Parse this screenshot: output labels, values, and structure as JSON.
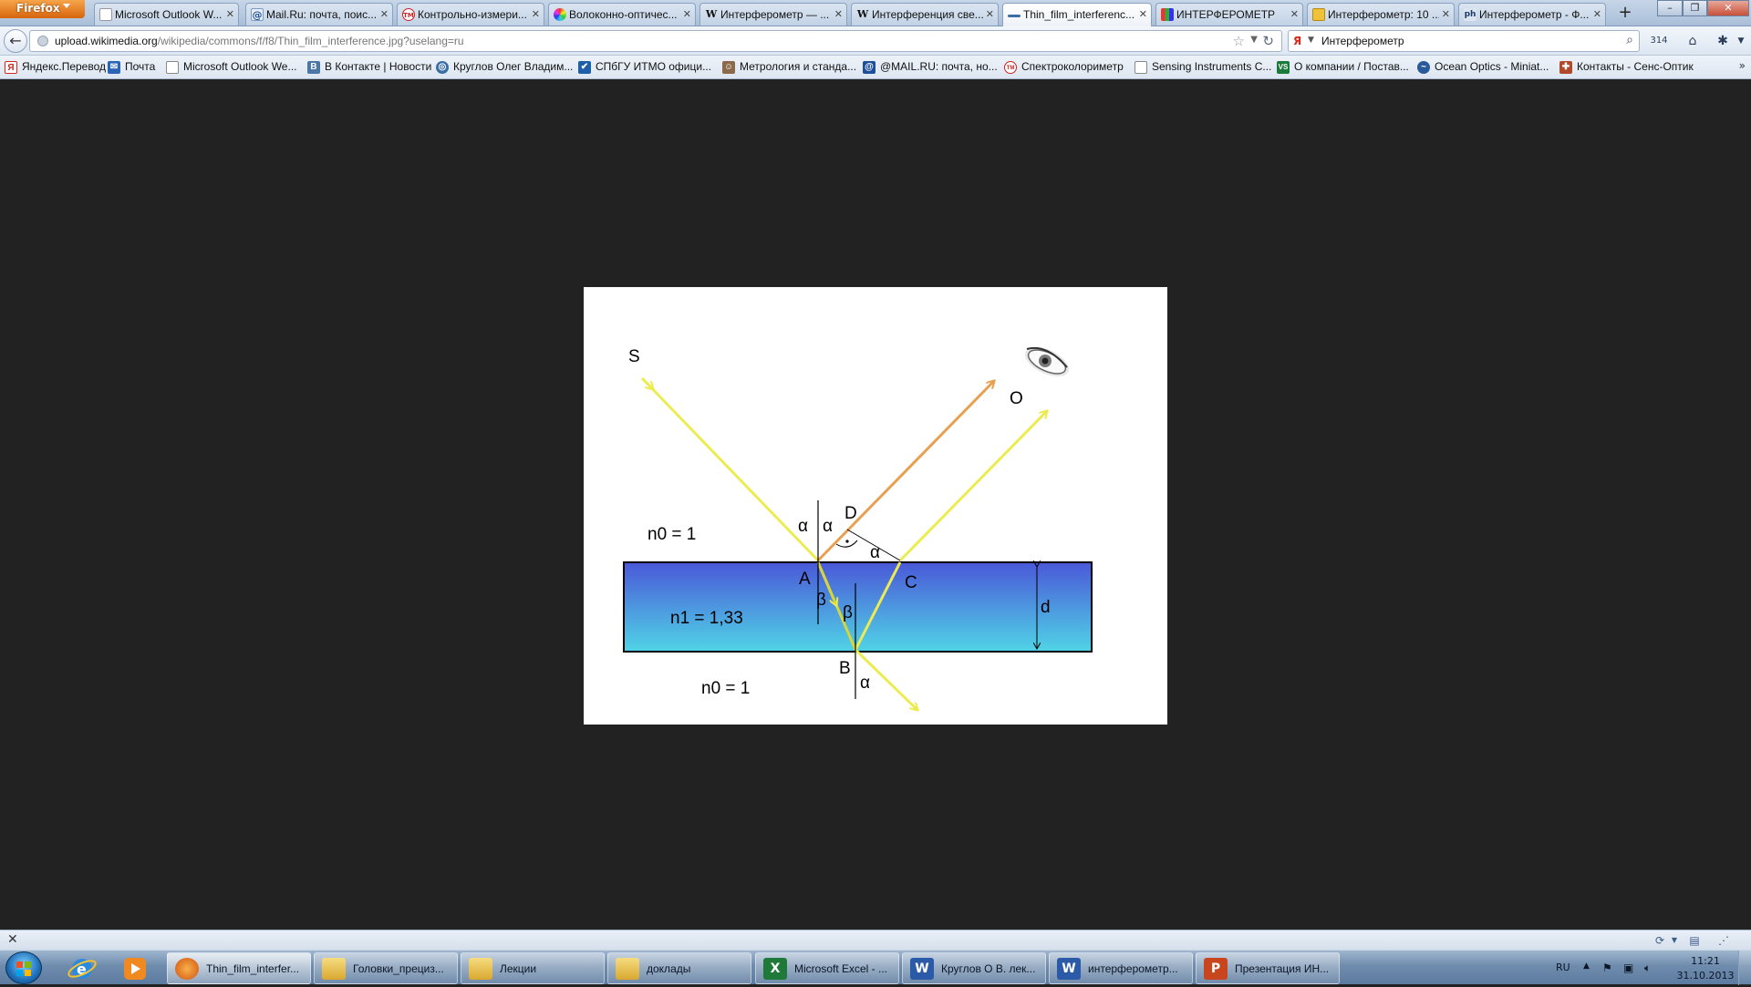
{
  "browser": {
    "app_button": "Firefox",
    "tabs": [
      {
        "title": "Microsoft Outlook W...",
        "icon": "page-icon",
        "active": false
      },
      {
        "title": "Mail.Ru: почта, поис...",
        "icon": "mailru-icon",
        "active": false
      },
      {
        "title": "Контрольно-измери...",
        "icon": "tm-icon",
        "active": false
      },
      {
        "title": "Волоконно-оптичес...",
        "icon": "color-wheel-icon",
        "active": false
      },
      {
        "title": "Интерферометр — ...",
        "icon": "wikipedia-icon",
        "active": false
      },
      {
        "title": "Интерференция све...",
        "icon": "wikipedia-icon",
        "active": false
      },
      {
        "title": "Thin_film_interferenc...",
        "icon": "wikimedia-icon",
        "active": true
      },
      {
        "title": "ИНТЕРФЕРОМЕТР",
        "icon": "chart-icon",
        "active": false
      },
      {
        "title": "Интерферометр: 10 ...",
        "icon": "yellow-page-icon",
        "active": false
      },
      {
        "title": "Интерферометр - Ф...",
        "icon": "ph-icon",
        "active": false
      }
    ],
    "new_tab_label": "+",
    "url_host": "upload.wikimedia.org",
    "url_prefix": "",
    "url_path": "/wikipedia/commons/f/f8/Thin_film_interference.jpg?uselang=ru",
    "search_text": "Интерферометр",
    "search_engine_letter": "Я",
    "bookmarks": [
      {
        "label": "Яндекс.Перевод",
        "icon": "yandex-icon",
        "color": "#d9261c"
      },
      {
        "label": "Почта",
        "icon": "mail-icon",
        "color": "#2a64b8"
      },
      {
        "label": "Microsoft Outlook We...",
        "icon": "page-icon",
        "color": "#ffffff"
      },
      {
        "label": "В Контакте | Новости",
        "icon": "vk-icon",
        "color": "#4a76a8"
      },
      {
        "label": "Круглов Олег Владим...",
        "icon": "globe-icon",
        "color": "#3a6ea5"
      },
      {
        "label": "СПбГУ ИТМО офици...",
        "icon": "itmo-icon",
        "color": "#1f5fa8"
      },
      {
        "label": "Метрология и станда...",
        "icon": "person-icon",
        "color": "#8a6a4a"
      },
      {
        "label": "@MAIL.RU: почта, но...",
        "icon": "mailru-icon",
        "color": "#1f4f9a"
      },
      {
        "label": "Спектроколориметр",
        "icon": "tm-icon",
        "color": "#c22"
      },
      {
        "label": "Sensing Instruments C...",
        "icon": "page-icon",
        "color": "#ffffff"
      },
      {
        "label": "О компании / Постав...",
        "icon": "vs-icon",
        "color": "#1a7a3a"
      },
      {
        "label": "Ocean Optics - Miniat...",
        "icon": "ocean-icon",
        "color": "#2a5a9a"
      },
      {
        "label": "Контакты - Сенс-Оптик",
        "icon": "sens-icon",
        "color": "#b04a2a"
      }
    ],
    "bookmarks_more": "»"
  },
  "figure": {
    "labels": {
      "S": "S",
      "O": "O",
      "D": "D",
      "A": "A",
      "B": "B",
      "C": "C",
      "d": "d",
      "alpha": "α",
      "beta": "β",
      "n0_top": "n0 = 1",
      "n1": "n1 = 1,33",
      "n0_bottom": "n0 = 1"
    },
    "colors": {
      "ray_yellow": "#ecec52",
      "ray_orange": "#e8a050",
      "film_top": "#4a58d8",
      "film_bottom": "#50d4e6"
    }
  },
  "taskbar": {
    "tasks": [
      {
        "label": "Thin_film_interfer...",
        "icon": "firefox-icon",
        "color": "#e0701a",
        "active": true
      },
      {
        "label": "Головки_прециз...",
        "icon": "folder-icon",
        "color": "#e8c050",
        "active": false
      },
      {
        "label": "Лекции",
        "icon": "folder-icon",
        "color": "#e8c050",
        "active": false
      },
      {
        "label": "доклады",
        "icon": "folder-icon",
        "color": "#e8c050",
        "active": false
      },
      {
        "label": "Microsoft Excel - ...",
        "icon": "excel-icon",
        "color": "#1f7a3a",
        "active": false
      },
      {
        "label": "Круглов О В. лек...",
        "icon": "word-icon",
        "color": "#2a5aa8",
        "active": false
      },
      {
        "label": "интерферометр...",
        "icon": "word-icon",
        "color": "#2a5aa8",
        "active": false
      },
      {
        "label": "Презентация ИН...",
        "icon": "powerpoint-icon",
        "color": "#c8451e",
        "active": false
      }
    ],
    "language": "RU",
    "time": "11:21",
    "date": "31.10.2013"
  }
}
